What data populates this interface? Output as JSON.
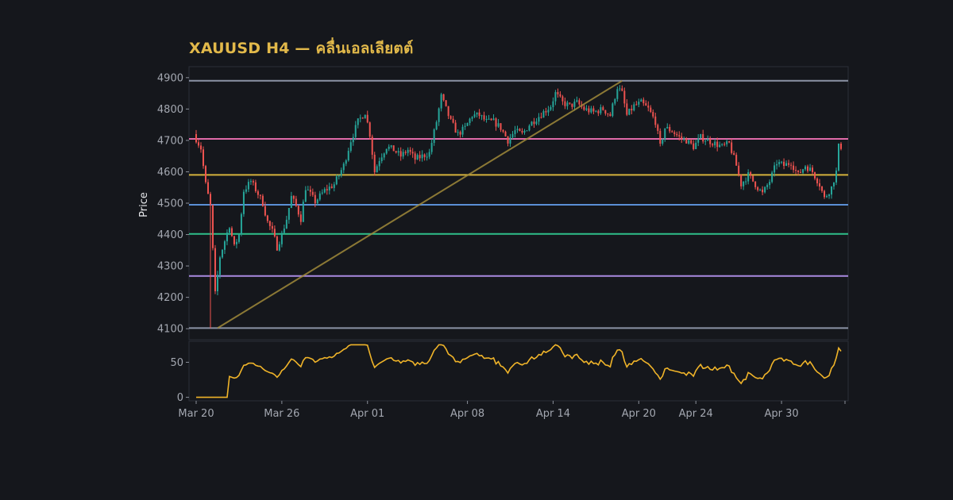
{
  "chart_data": {
    "type": "candlestick",
    "title": "XAUUSD H4 — คลื่นเอลเลียตต์",
    "ylabel": "Price",
    "price_axis": {
      "ylim": [
        4065,
        4935
      ],
      "ticks": [
        4100,
        4200,
        4300,
        4400,
        4500,
        4600,
        4700,
        4800,
        4900
      ]
    },
    "oscillator_axis": {
      "ylim": [
        -5,
        80
      ],
      "ticks": [
        0,
        50
      ]
    },
    "x_axis": {
      "range": [
        "2026-03-20",
        "2026-05-04T04:00"
      ],
      "ticks": [
        {
          "date": "2026-03-20",
          "label": "Mar 20"
        },
        {
          "date": "2026-03-26",
          "label": "Mar 26"
        },
        {
          "date": "2026-04-01",
          "label": "Apr 01"
        },
        {
          "date": "2026-04-08",
          "label": "Apr 08"
        },
        {
          "date": "2026-04-14",
          "label": "Apr 14"
        },
        {
          "date": "2026-04-20",
          "label": "Apr 20"
        },
        {
          "date": "2026-04-24",
          "label": "Apr 24"
        },
        {
          "date": "2026-04-30",
          "label": "Apr 30"
        }
      ]
    },
    "grid": false,
    "colors": {
      "up": "#26a69a",
      "down": "#ef5350",
      "oscillator": "#f0b429",
      "trendline": "#a08a3a"
    },
    "levels": [
      {
        "price": 4890,
        "color": "#8b93a5"
      },
      {
        "price": 4705,
        "color": "#e06aa8"
      },
      {
        "price": 4590,
        "color": "#d4b23c"
      },
      {
        "price": 4495,
        "color": "#5b8fd6"
      },
      {
        "price": 4402,
        "color": "#2fbf8a"
      },
      {
        "price": 4268,
        "color": "#a98ae0"
      },
      {
        "price": 4102,
        "color": "#8b93a5"
      }
    ],
    "trendline": {
      "from": {
        "date": "2026-03-21T12:00",
        "price": 4102
      },
      "to": {
        "date": "2026-04-18T20:00",
        "price": 4890
      }
    },
    "keypoints": [
      [
        "2026-03-20T00:00",
        4720
      ],
      [
        "2026-03-20T12:00",
        4675
      ],
      [
        "2026-03-20T20:00",
        4560
      ],
      [
        "2026-03-21T04:00",
        4490
      ],
      [
        "2026-03-21T08:00",
        4350
      ],
      [
        "2026-03-21T12:00",
        4210
      ],
      [
        "2026-03-21T20:00",
        4330
      ],
      [
        "2026-03-22T04:00",
        4380
      ],
      [
        "2026-03-22T12:00",
        4430
      ],
      [
        "2026-03-22T20:00",
        4360
      ],
      [
        "2026-03-23T04:00",
        4400
      ],
      [
        "2026-03-23T12:00",
        4540
      ],
      [
        "2026-03-24T00:00",
        4570
      ],
      [
        "2026-03-24T12:00",
        4530
      ],
      [
        "2026-03-24T20:00",
        4500
      ],
      [
        "2026-03-25T04:00",
        4440
      ],
      [
        "2026-03-25T12:00",
        4410
      ],
      [
        "2026-03-25T20:00",
        4360
      ],
      [
        "2026-03-26T04:00",
        4400
      ],
      [
        "2026-03-26T12:00",
        4450
      ],
      [
        "2026-03-26T20:00",
        4520
      ],
      [
        "2026-03-27T04:00",
        4490
      ],
      [
        "2026-03-27T12:00",
        4450
      ],
      [
        "2026-03-27T20:00",
        4550
      ],
      [
        "2026-03-28T12:00",
        4505
      ],
      [
        "2026-03-29T04:00",
        4540
      ],
      [
        "2026-03-29T20:00",
        4560
      ],
      [
        "2026-03-30T12:00",
        4620
      ],
      [
        "2026-03-31T00:00",
        4700
      ],
      [
        "2026-03-31T12:00",
        4760
      ],
      [
        "2026-04-01T00:00",
        4790
      ],
      [
        "2026-04-01T08:00",
        4720
      ],
      [
        "2026-04-01T16:00",
        4600
      ],
      [
        "2026-04-02T00:00",
        4640
      ],
      [
        "2026-04-02T12:00",
        4680
      ],
      [
        "2026-04-03T00:00",
        4670
      ],
      [
        "2026-04-03T12:00",
        4650
      ],
      [
        "2026-04-04T00:00",
        4670
      ],
      [
        "2026-04-04T12:00",
        4640
      ],
      [
        "2026-04-05T00:00",
        4650
      ],
      [
        "2026-04-05T12:00",
        4660
      ],
      [
        "2026-04-06T00:00",
        4760
      ],
      [
        "2026-04-06T08:00",
        4840
      ],
      [
        "2026-04-06T16:00",
        4800
      ],
      [
        "2026-04-07T00:00",
        4760
      ],
      [
        "2026-04-07T12:00",
        4720
      ],
      [
        "2026-04-08T00:00",
        4740
      ],
      [
        "2026-04-08T12:00",
        4780
      ],
      [
        "2026-04-09T00:00",
        4780
      ],
      [
        "2026-04-09T12:00",
        4760
      ],
      [
        "2026-04-10T00:00",
        4760
      ],
      [
        "2026-04-10T12:00",
        4740
      ],
      [
        "2026-04-11T00:00",
        4700
      ],
      [
        "2026-04-11T12:00",
        4730
      ],
      [
        "2026-04-12T00:00",
        4720
      ],
      [
        "2026-04-12T12:00",
        4750
      ],
      [
        "2026-04-13T00:00",
        4770
      ],
      [
        "2026-04-13T12:00",
        4790
      ],
      [
        "2026-04-14T00:00",
        4810
      ],
      [
        "2026-04-14T08:00",
        4850
      ],
      [
        "2026-04-14T20:00",
        4820
      ],
      [
        "2026-04-15T08:00",
        4810
      ],
      [
        "2026-04-15T20:00",
        4820
      ],
      [
        "2026-04-16T08:00",
        4800
      ],
      [
        "2026-04-17T00:00",
        4790
      ],
      [
        "2026-04-17T16:00",
        4800
      ],
      [
        "2026-04-18T04:00",
        4780
      ],
      [
        "2026-04-18T16:00",
        4870
      ],
      [
        "2026-04-19T00:00",
        4850
      ],
      [
        "2026-04-19T08:00",
        4780
      ],
      [
        "2026-04-19T20:00",
        4810
      ],
      [
        "2026-04-20T08:00",
        4820
      ],
      [
        "2026-04-20T20:00",
        4800
      ],
      [
        "2026-04-21T08:00",
        4760
      ],
      [
        "2026-04-21T16:00",
        4680
      ],
      [
        "2026-04-22T00:00",
        4740
      ],
      [
        "2026-04-22T12:00",
        4730
      ],
      [
        "2026-04-23T00:00",
        4710
      ],
      [
        "2026-04-23T12:00",
        4700
      ],
      [
        "2026-04-24T00:00",
        4680
      ],
      [
        "2026-04-24T12:00",
        4710
      ],
      [
        "2026-04-25T00:00",
        4700
      ],
      [
        "2026-04-25T12:00",
        4690
      ],
      [
        "2026-04-26T00:00",
        4680
      ],
      [
        "2026-04-26T12:00",
        4690
      ],
      [
        "2026-04-27T00:00",
        4620
      ],
      [
        "2026-04-27T08:00",
        4560
      ],
      [
        "2026-04-27T20:00",
        4590
      ],
      [
        "2026-04-28T08:00",
        4560
      ],
      [
        "2026-04-28T20:00",
        4530
      ],
      [
        "2026-04-29T08:00",
        4570
      ],
      [
        "2026-04-29T20:00",
        4630
      ],
      [
        "2026-04-30T08:00",
        4620
      ],
      [
        "2026-04-30T20:00",
        4630
      ],
      [
        "2026-05-01T08:00",
        4590
      ],
      [
        "2026-05-01T20:00",
        4620
      ],
      [
        "2026-05-02T08:00",
        4600
      ],
      [
        "2026-05-02T20:00",
        4560
      ],
      [
        "2026-05-03T04:00",
        4515
      ],
      [
        "2026-05-03T16:00",
        4550
      ],
      [
        "2026-05-04T00:00",
        4600
      ],
      [
        "2026-05-04T04:00",
        4680
      ]
    ]
  }
}
